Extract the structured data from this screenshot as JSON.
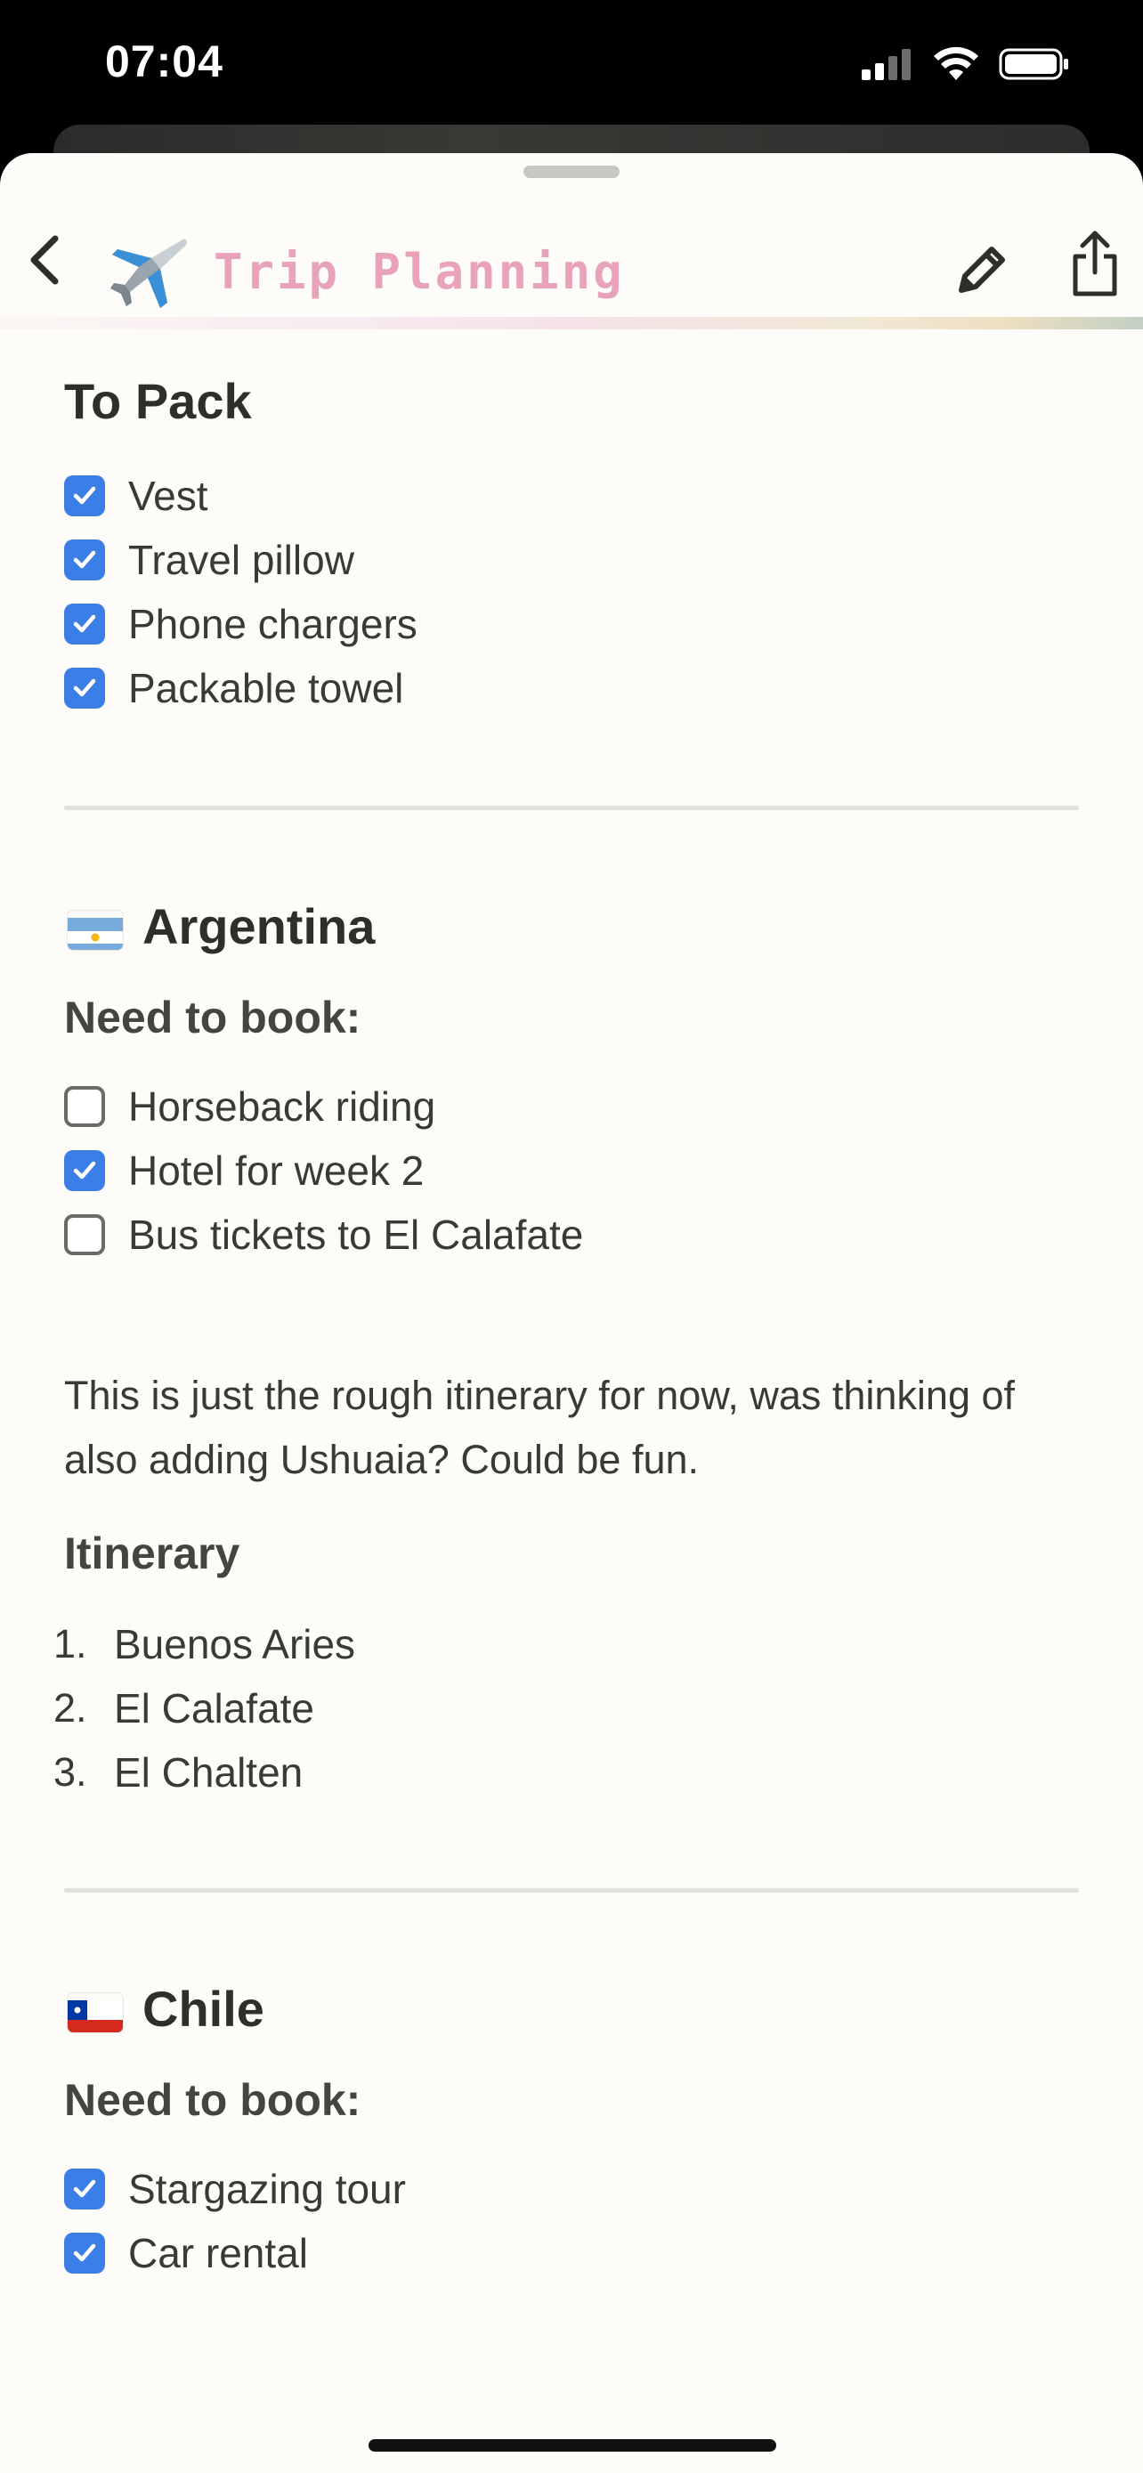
{
  "status": {
    "time": "07:04"
  },
  "header": {
    "title": "Trip Planning",
    "title_icon": "airplane-icon"
  },
  "pack": {
    "heading": "To Pack",
    "items": [
      {
        "label": "Vest",
        "checked": true
      },
      {
        "label": "Travel pillow",
        "checked": true
      },
      {
        "label": "Phone chargers",
        "checked": true
      },
      {
        "label": "Packable towel",
        "checked": true
      }
    ]
  },
  "argentina": {
    "flag": "argentina-flag",
    "heading": "Argentina",
    "book_heading": "Need to book:",
    "items": [
      {
        "label": "Horseback riding",
        "checked": false
      },
      {
        "label": "Hotel for week 2",
        "checked": true
      },
      {
        "label": "Bus tickets to El Calafate",
        "checked": false
      }
    ],
    "note": "This is just the rough itinerary for now, was thinking of also adding Ushuaia? Could be fun.",
    "itinerary_heading": "Itinerary",
    "itinerary": [
      {
        "num": "1.",
        "label": "Buenos Aries"
      },
      {
        "num": "2.",
        "label": "El Calafate"
      },
      {
        "num": "3.",
        "label": "El Chalten"
      }
    ]
  },
  "chile": {
    "flag": "chile-flag",
    "heading": "Chile",
    "book_heading": "Need to book:",
    "items": [
      {
        "label": "Stargazing tour",
        "checked": true
      },
      {
        "label": "Car rental",
        "checked": true
      }
    ]
  },
  "colors": {
    "accent": "#3b7ee8",
    "title": "#e8a3bb",
    "background": "#fdfcf8"
  }
}
